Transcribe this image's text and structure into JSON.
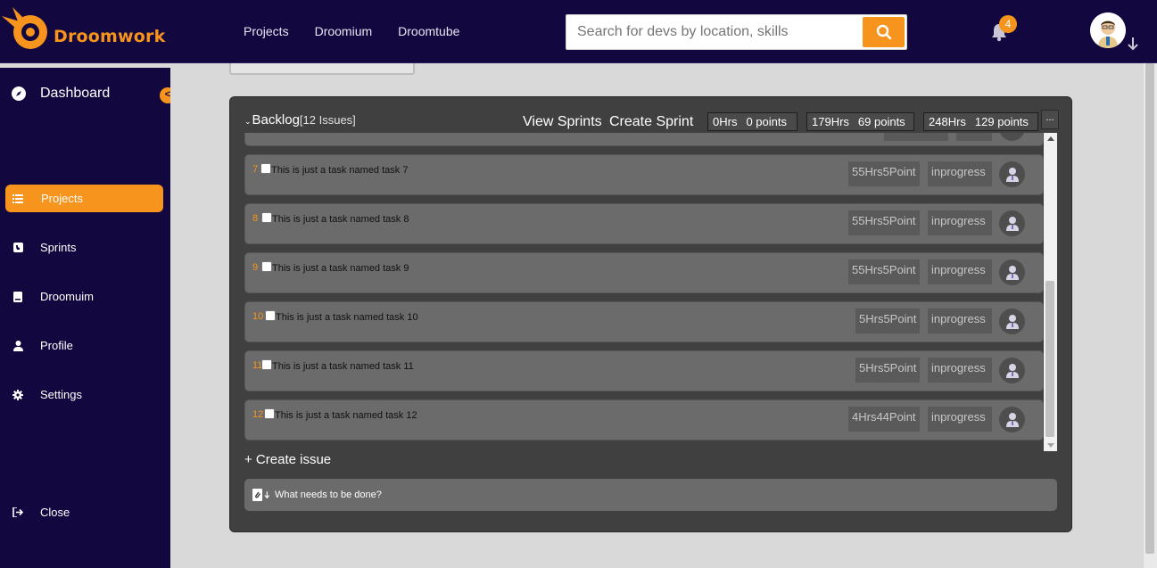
{
  "brand": {
    "name": "Droomwork",
    "accent": "#f7941d",
    "navy": "#12073f"
  },
  "nav": {
    "links": [
      "Projects",
      "Droomium",
      "Droomtube"
    ]
  },
  "search": {
    "placeholder": "Search for devs by location, skills",
    "icon": "search-icon"
  },
  "notifications": {
    "count": "4",
    "icon": "bell-icon"
  },
  "sidebar": {
    "dashboard": "Dashboard",
    "collapse": "<",
    "items": [
      {
        "label": "Projects",
        "icon": "list-icon",
        "active": true
      },
      {
        "label": "Sprints",
        "icon": "phone-icon",
        "active": false
      },
      {
        "label": "Droomuim",
        "icon": "book-icon",
        "active": false
      },
      {
        "label": "Profile",
        "icon": "user-icon",
        "active": false
      },
      {
        "label": "Settings",
        "icon": "gear-icon",
        "active": false
      }
    ],
    "close": "Close"
  },
  "backlog": {
    "title": "Backlog",
    "count": "[12 Issues]",
    "view_sprints": "View Sprints",
    "create_sprint": "Create Sprint",
    "stats": [
      {
        "hrs": "0Hrs",
        "points": "0 points"
      },
      {
        "hrs": "179Hrs",
        "points": "69 points"
      },
      {
        "hrs": "248Hrs",
        "points": "129 points"
      }
    ],
    "more": "...",
    "issues": [
      {
        "num": "7",
        "title": "This is just a task named task 7",
        "estimate": "55Hrs5Point",
        "status": "inprogress"
      },
      {
        "num": "8",
        "title": "This is just a task named task 8",
        "estimate": "55Hrs5Point",
        "status": "inprogress"
      },
      {
        "num": "9",
        "title": "This is just a task named task 9",
        "estimate": "55Hrs5Point",
        "status": "inprogress"
      },
      {
        "num": "10",
        "title": "This is just a task named task 10",
        "estimate": "5Hrs5Point",
        "status": "inprogress"
      },
      {
        "num": "11",
        "title": "This is just a task named task 11",
        "estimate": "5Hrs5Point",
        "status": "inprogress"
      },
      {
        "num": "12",
        "title": "This is just a task named task 12",
        "estimate": "4Hrs44Point",
        "status": "inprogress"
      }
    ],
    "create_issue": "+ Create issue",
    "new_issue_placeholder": "What needs to be done?"
  }
}
